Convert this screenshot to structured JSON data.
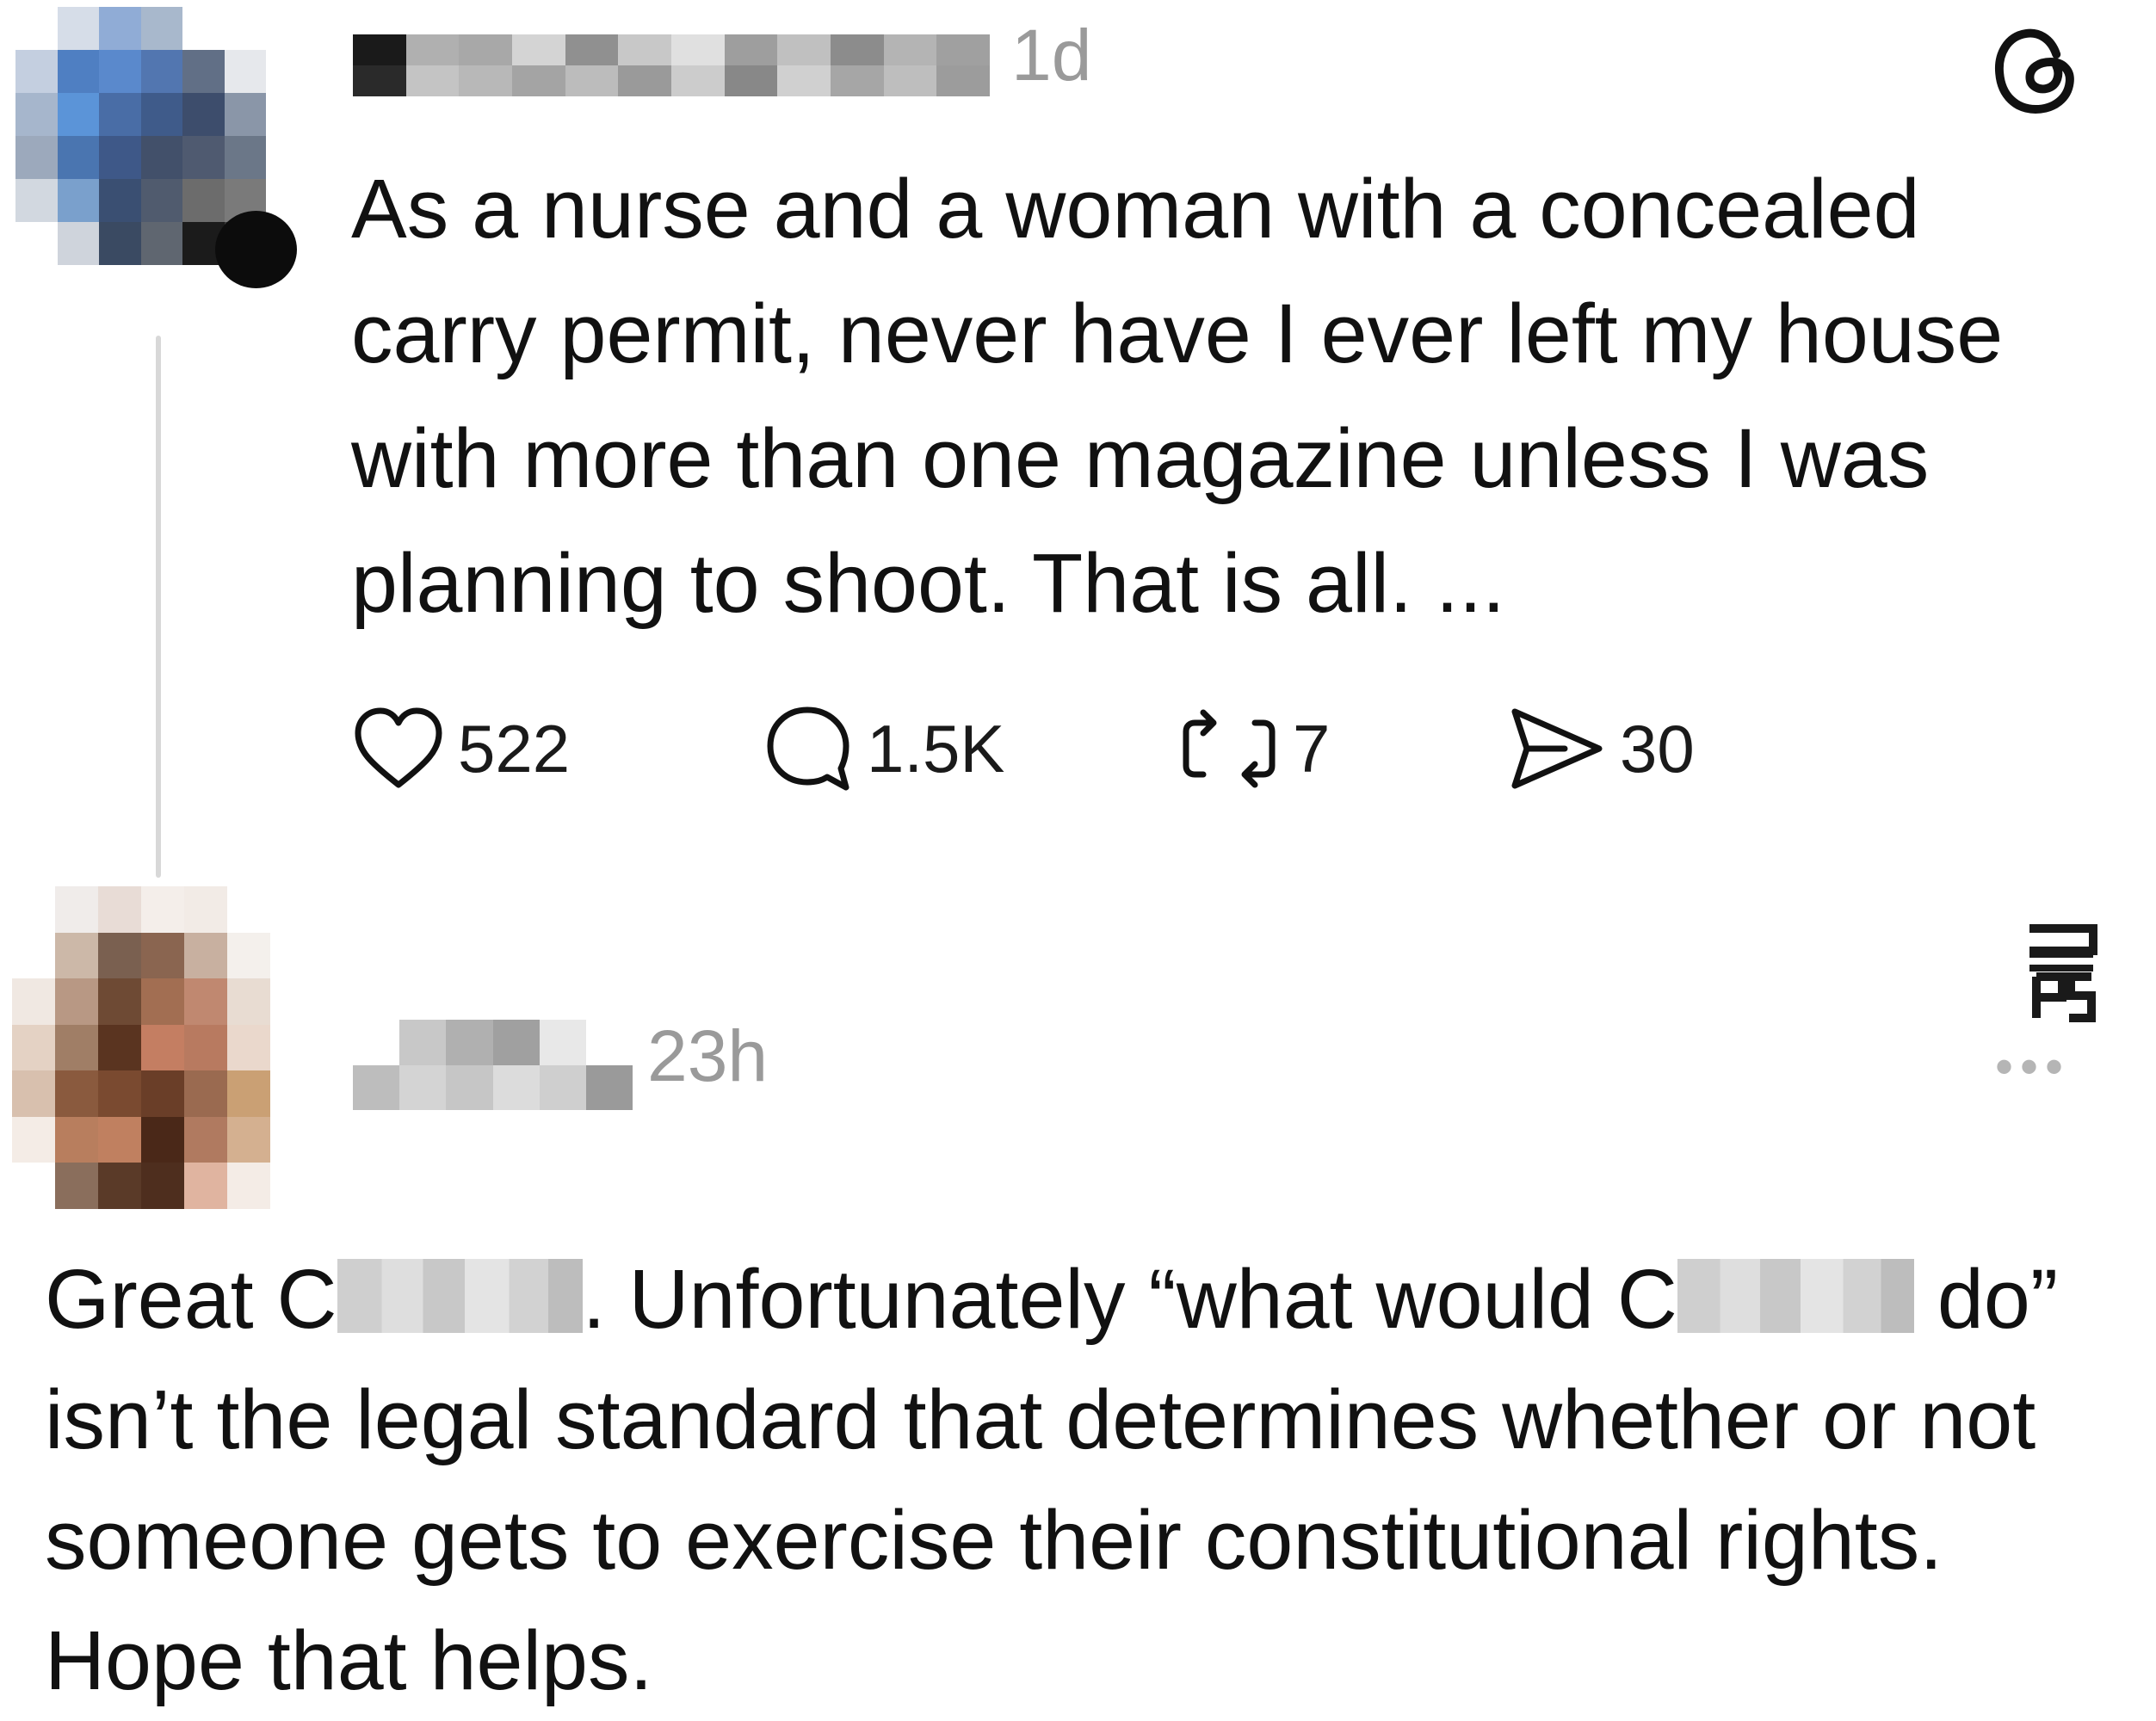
{
  "post": {
    "time": "1d",
    "body": "As a nurse and a woman with a concealed carry permit, never have I ever left my house with more than one magazine unless I was planning to shoot. That is all. ...",
    "actions": {
      "likes": "522",
      "replies": "1.5K",
      "reposts": "7",
      "shares": "30"
    },
    "icons": {
      "app": "threads-icon",
      "like": "heart-icon",
      "reply": "speech-bubble-icon",
      "repost": "repost-icon",
      "share": "send-icon"
    }
  },
  "reply": {
    "time": "23h",
    "more": "•••",
    "body_part1": "Great C",
    "body_part2": ". Unfortunately “what would C",
    "body_part3": " do” isn’t the legal standard that determines whether or not someone gets to exercise their constitutional rights. Hope that helps."
  },
  "colors": {
    "text": "#111111",
    "muted": "#9a9a9a",
    "thread_line": "#d8d8d8"
  }
}
